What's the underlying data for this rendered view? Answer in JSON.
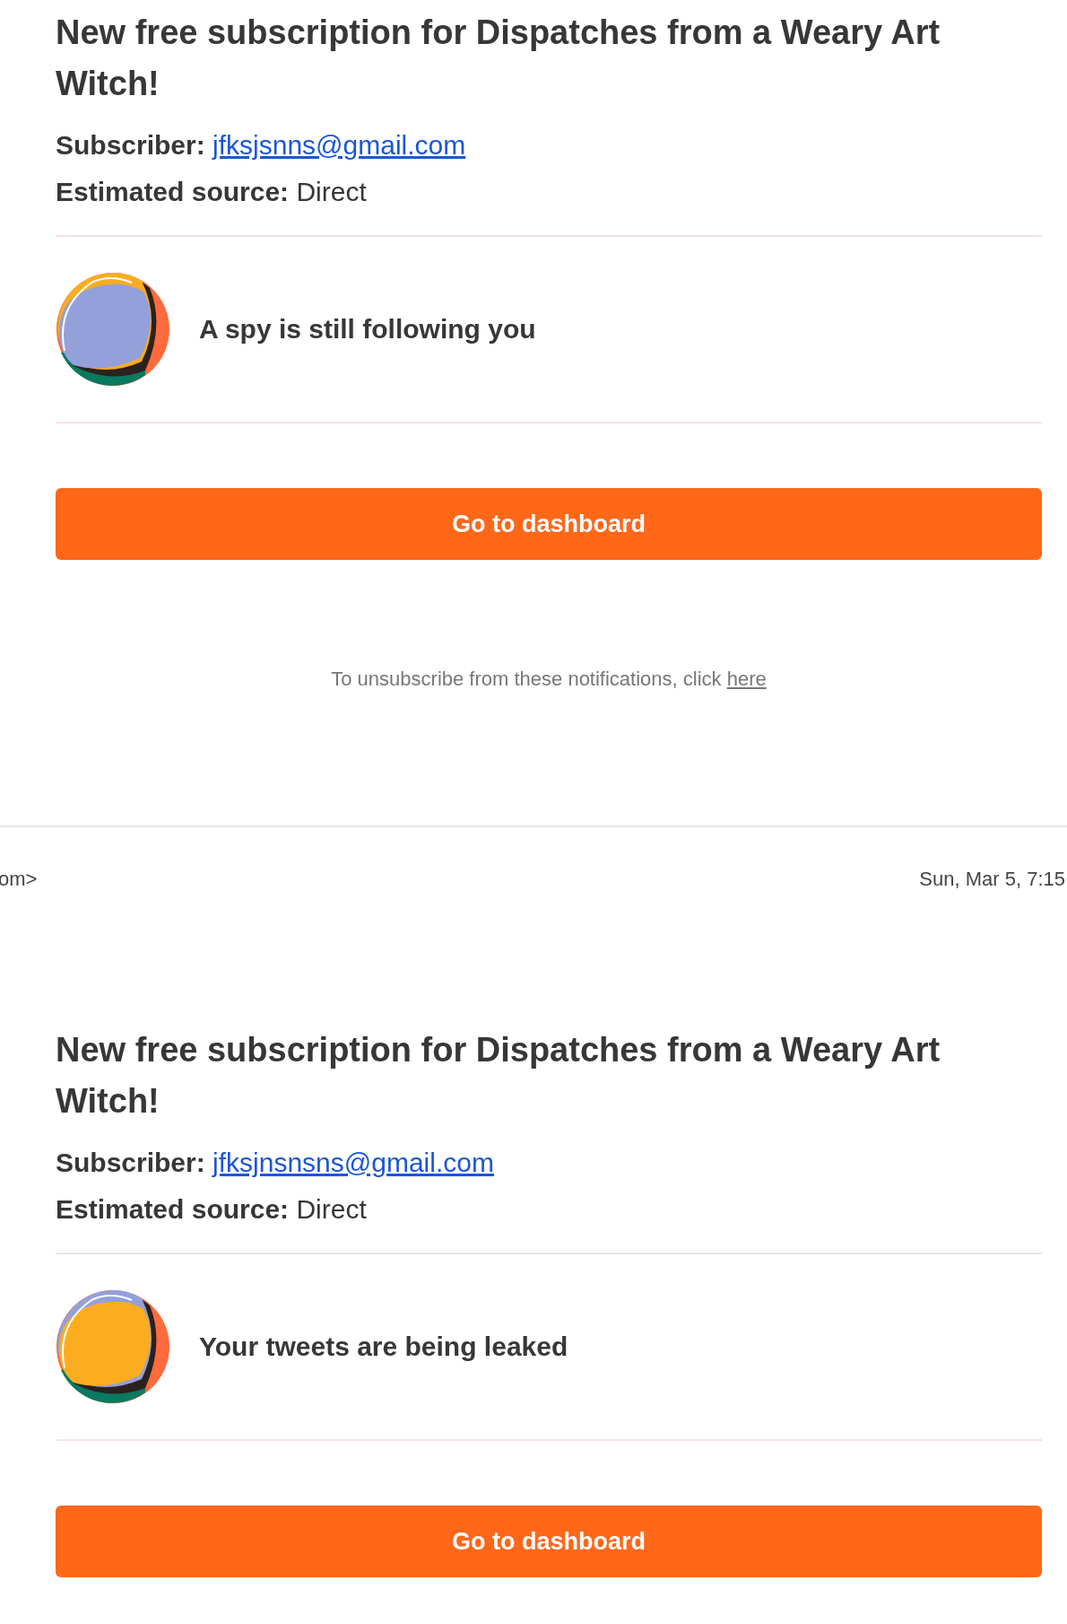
{
  "items": [
    {
      "kind": "email",
      "title": "New free subscription for Dispatches from a Weary Art Witch!",
      "subscriber_label": "Subscriber:",
      "subscriber_email": "jfksjsnns@gmail.com",
      "source_label": "Estimated source:",
      "source": "Direct",
      "avatar": {
        "color": "#94a0da",
        "rim": {
          "color": "#fbad1f"
        }
      },
      "message": "A spy is still following you",
      "button": "Go to dashboard",
      "footer": {
        "text": "To unsubscribe from these notifications, click ",
        "link": "here"
      }
    },
    {
      "kind": "header",
      "sender": "om>",
      "date": "Sun, Mar 5, 7:15"
    },
    {
      "kind": "email",
      "title": "New free subscription for Dispatches from a Weary Art Witch!",
      "subscriber_label": "Subscriber:",
      "subscriber_email": "jfksjnsnsns@gmail.com",
      "source_label": "Estimated source:",
      "source": "Direct",
      "avatar": {
        "color": "#fbad1f",
        "rim": {
          "color": "#94a0da"
        }
      },
      "message": "Your tweets are being leaked",
      "button": "Go to dashboard"
    }
  ]
}
